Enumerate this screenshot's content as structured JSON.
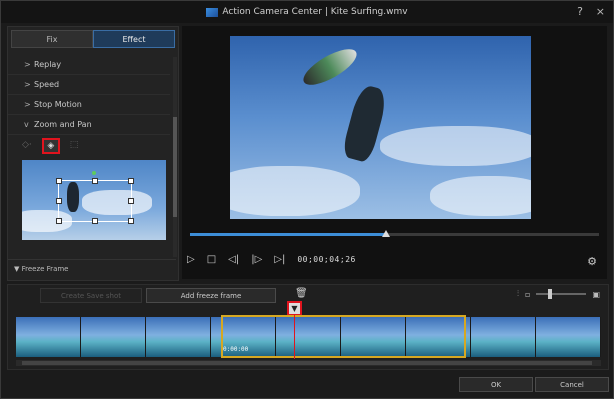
{
  "window": {
    "title": "Action Camera Center",
    "file": "Kite Surfing.wmv",
    "help_icon": "?",
    "close_icon": "×"
  },
  "left_panel": {
    "tabs": [
      {
        "label": "Fix",
        "active": false
      },
      {
        "label": "Effect",
        "active": true
      }
    ],
    "accordion": [
      {
        "label": "Replay",
        "expanded": false
      },
      {
        "label": "Speed",
        "expanded": false
      },
      {
        "label": "Stop Motion",
        "expanded": false
      },
      {
        "label": "Zoom and Pan",
        "expanded": true
      }
    ],
    "freeze_frame_label": "Freeze Frame"
  },
  "player": {
    "timecode": "00;00;04;26",
    "progress": 0.48
  },
  "timeline": {
    "create_save_shot_label": "Create Save shot",
    "add_freeze_frame_label": "Add freeze frame",
    "freeze_time": "0:00:00",
    "frame_count": 9
  },
  "footer": {
    "ok_label": "OK",
    "cancel_label": "Cancel"
  },
  "colors": {
    "accent": "#3d8ed8",
    "highlight": "#e0141e",
    "freeze_border": "#d6a822"
  }
}
